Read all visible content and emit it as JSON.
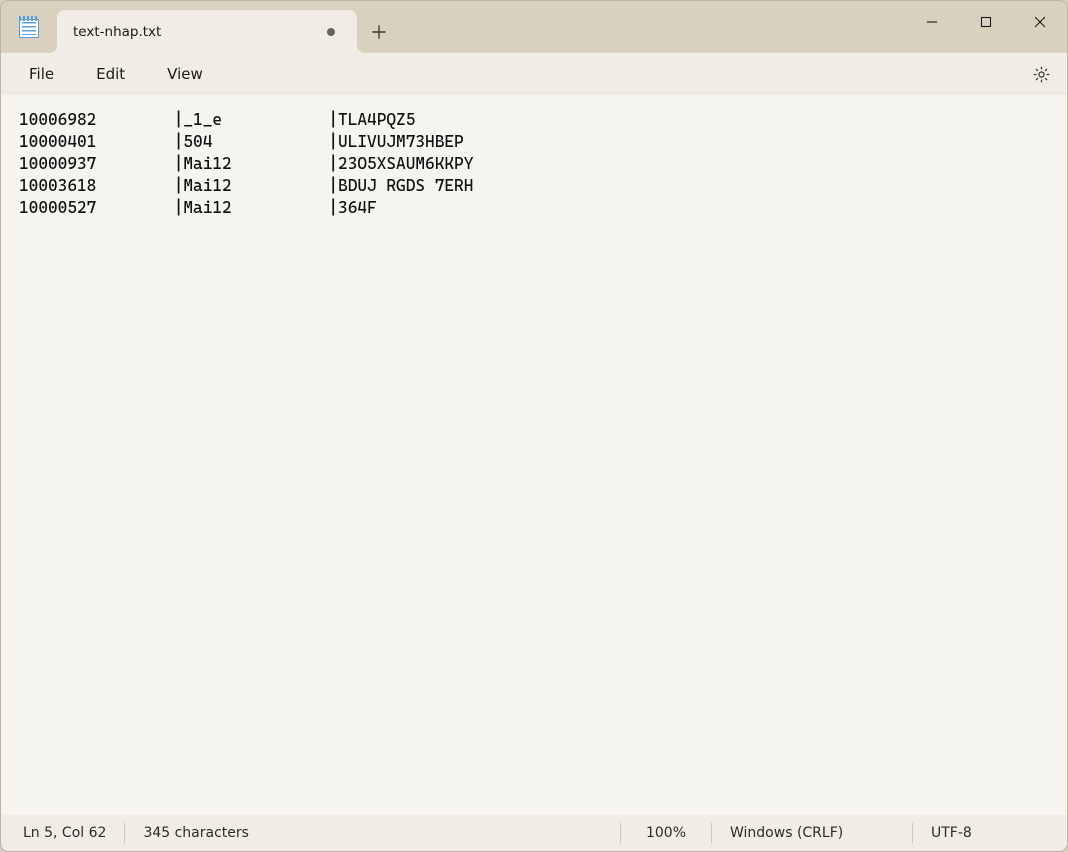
{
  "tab": {
    "title": "text-nhap.txt",
    "dirty": true
  },
  "menubar": {
    "file": "File",
    "edit": "Edit",
    "view": "View"
  },
  "editor": {
    "content": "10006982\t|_1_e\t\t|TLA4PQZ5\n10000401\t|504\t\t|ULIVUJM73HBEP\n10000937\t|Mai12\t\t|23O5XSAUM6KKPY\n10003618\t|Mai12\t\t|BDUJ RGDS 7ERH\n10000527\t|Mai12\t\t|364F",
    "lines": [
      "10006982\t|_1_e\t\t|TLA4PQZ5",
      "10000401\t|504\t\t|ULIVUJM73HBEP",
      "10000937\t|Mai12\t\t|23O5XSAUM6KKPY",
      "10003618\t|Mai12\t\t|BDUJ RGDS 7ERH",
      "10000527\t|Mai12\t\t|364F"
    ]
  },
  "statusbar": {
    "position": "Ln 5, Col 62",
    "characters": "345 characters",
    "zoom": "100%",
    "line_ending": "Windows (CRLF)",
    "encoding": "UTF-8"
  },
  "icons": {
    "app": "notepad-icon",
    "new_tab": "plus-icon",
    "minimize": "minimize-icon",
    "maximize": "maximize-icon",
    "close": "close-icon",
    "settings": "gear-icon",
    "tab_dirty": "unsaved-dot-icon"
  }
}
